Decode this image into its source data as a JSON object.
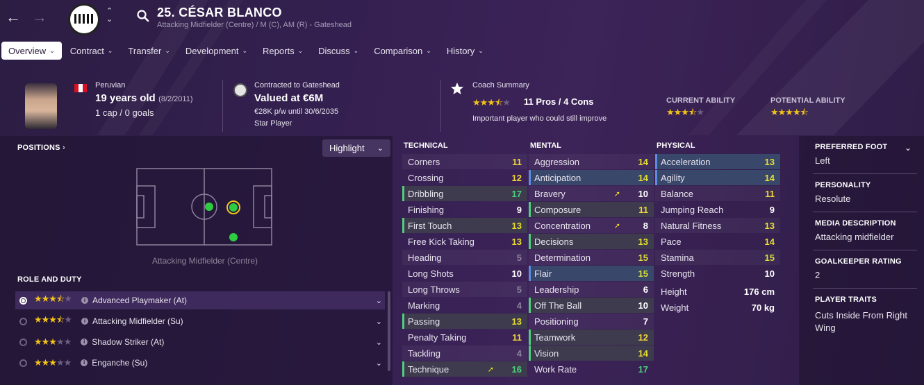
{
  "nav": {
    "back": "←",
    "forward": "→",
    "up": "⌃",
    "down": "⌄"
  },
  "player": {
    "title": "25. CÉSAR BLANCO",
    "subtitle": "Attacking Midfielder (Centre) / M (C), AM (R) - Gateshead"
  },
  "tabs": [
    {
      "label": "Overview",
      "active": true
    },
    {
      "label": "Contract"
    },
    {
      "label": "Transfer"
    },
    {
      "label": "Development"
    },
    {
      "label": "Reports"
    },
    {
      "label": "Discuss"
    },
    {
      "label": "Comparison"
    },
    {
      "label": "History"
    }
  ],
  "bio": {
    "nationality": "Peruvian",
    "age": "19 years old",
    "dob": "(8/2/2011)",
    "caps": "1 cap / 0 goals"
  },
  "contract": {
    "club_line": "Contracted to Gateshead",
    "value": "Valued at €6M",
    "wage": "€28K p/w until 30/6/2035",
    "status": "Star Player"
  },
  "coach": {
    "label": "Coach Summary",
    "pros_cons": "11 Pros / 4 Cons",
    "summary": "Important player who could still improve",
    "stars": 3.5
  },
  "ability": {
    "current_label": "CURRENT ABILITY",
    "potential_label": "POTENTIAL ABILITY",
    "current_stars": 3.5,
    "potential_stars": 4.5
  },
  "positions": {
    "header": "POSITIONS",
    "highlight": "Highlight",
    "position_label": "Attacking Midfielder (Centre)"
  },
  "role_duty": {
    "header": "ROLE AND DUTY",
    "roles": [
      {
        "name": "Advanced Playmaker (At)",
        "stars": 3.5,
        "selected": true
      },
      {
        "name": "Attacking Midfielder (Su)",
        "stars": 3.5
      },
      {
        "name": "Shadow Striker (At)",
        "stars": 3
      },
      {
        "name": "Enganche (Su)",
        "stars": 3
      }
    ]
  },
  "attributes": {
    "technical_header": "TECHNICAL",
    "mental_header": "MENTAL",
    "physical_header": "PHYSICAL",
    "technical": [
      {
        "name": "Corners",
        "value": "11"
      },
      {
        "name": "Crossing",
        "value": "12"
      },
      {
        "name": "Dribbling",
        "value": "17",
        "style": "hl"
      },
      {
        "name": "Finishing",
        "value": "9"
      },
      {
        "name": "First Touch",
        "value": "13",
        "style": "hl"
      },
      {
        "name": "Free Kick Taking",
        "value": "13"
      },
      {
        "name": "Heading",
        "value": "5"
      },
      {
        "name": "Long Shots",
        "value": "10"
      },
      {
        "name": "Long Throws",
        "value": "5"
      },
      {
        "name": "Marking",
        "value": "4"
      },
      {
        "name": "Passing",
        "value": "13",
        "style": "hl"
      },
      {
        "name": "Penalty Taking",
        "value": "11"
      },
      {
        "name": "Tackling",
        "value": "4"
      },
      {
        "name": "Technique",
        "value": "16",
        "style": "hl",
        "trend": "up"
      }
    ],
    "mental": [
      {
        "name": "Aggression",
        "value": "14"
      },
      {
        "name": "Anticipation",
        "value": "14",
        "style": "blue"
      },
      {
        "name": "Bravery",
        "value": "10",
        "trend": "up"
      },
      {
        "name": "Composure",
        "value": "11",
        "style": "hl"
      },
      {
        "name": "Concentration",
        "value": "8",
        "trend": "up"
      },
      {
        "name": "Decisions",
        "value": "13",
        "style": "hl"
      },
      {
        "name": "Determination",
        "value": "15"
      },
      {
        "name": "Flair",
        "value": "15",
        "style": "blue"
      },
      {
        "name": "Leadership",
        "value": "6"
      },
      {
        "name": "Off The Ball",
        "value": "10",
        "style": "hl"
      },
      {
        "name": "Positioning",
        "value": "7"
      },
      {
        "name": "Teamwork",
        "value": "12",
        "style": "hl"
      },
      {
        "name": "Vision",
        "value": "14",
        "style": "hl"
      },
      {
        "name": "Work Rate",
        "value": "17"
      }
    ],
    "physical": [
      {
        "name": "Acceleration",
        "value": "13",
        "style": "blue"
      },
      {
        "name": "Agility",
        "value": "14",
        "style": "blue"
      },
      {
        "name": "Balance",
        "value": "11"
      },
      {
        "name": "Jumping Reach",
        "value": "9"
      },
      {
        "name": "Natural Fitness",
        "value": "13"
      },
      {
        "name": "Pace",
        "value": "14"
      },
      {
        "name": "Stamina",
        "value": "15"
      },
      {
        "name": "Strength",
        "value": "10"
      }
    ],
    "height_label": "Height",
    "height": "176 cm",
    "weight_label": "Weight",
    "weight": "70 kg"
  },
  "profile": {
    "preferred_foot_label": "PREFERRED FOOT",
    "preferred_foot": "Left",
    "personality_label": "PERSONALITY",
    "personality": "Resolute",
    "media_label": "MEDIA DESCRIPTION",
    "media": "Attacking midfielder",
    "gk_label": "GOALKEEPER RATING",
    "gk": "2",
    "traits_label": "PLAYER TRAITS",
    "traits": "Cuts Inside From Right Wing"
  },
  "colors": {
    "accent_green": "#4cd07d",
    "accent_yellow": "#f0d63a",
    "accent_blue": "#5c8de0",
    "background": "#342050"
  }
}
